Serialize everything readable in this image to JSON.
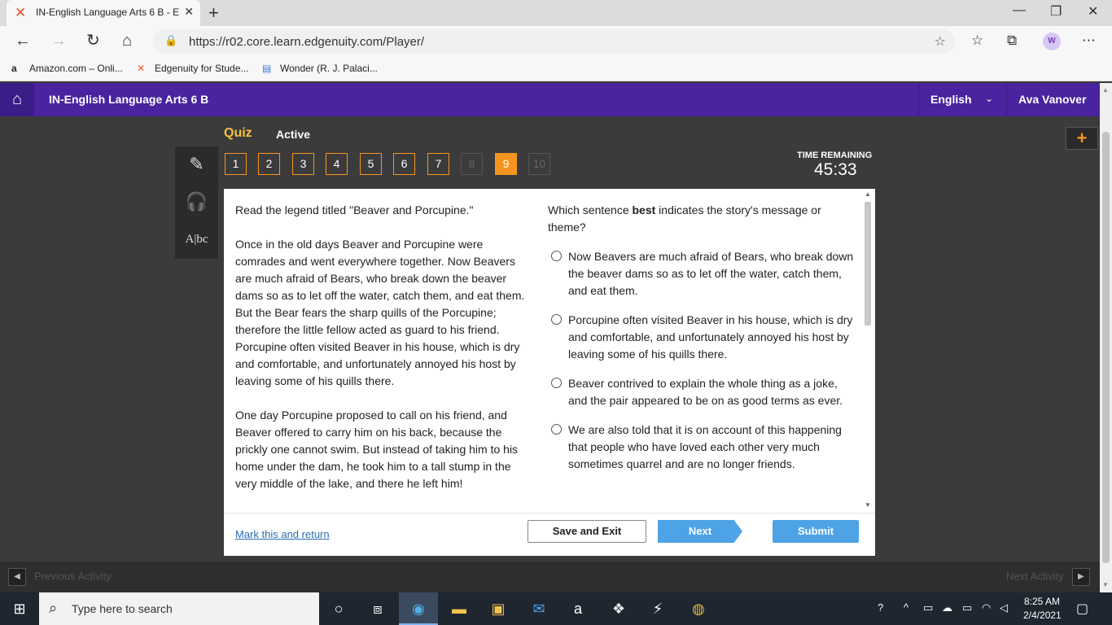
{
  "browser": {
    "tab_title": "IN-English Language Arts 6 B - E",
    "url": "https://r02.core.learn.edgenuity.com/Player/",
    "profile_initial": "W",
    "bookmarks": [
      "Amazon.com – Onli...",
      "Edgenuity for Stude...",
      "Wonder (R. J. Palaci..."
    ]
  },
  "app": {
    "course_title": "IN-English Language Arts 6 B",
    "language": "English",
    "user": "Ava Vanover"
  },
  "quiz": {
    "label": "Quiz",
    "status": "Active",
    "questions": [
      "1",
      "2",
      "3",
      "4",
      "5",
      "6",
      "7",
      "8",
      "9",
      "10"
    ],
    "current_question": "9",
    "timer_label": "TIME REMAINING",
    "timer_value": "45:33"
  },
  "passage": {
    "p1": "Read the legend titled \"Beaver and Porcupine.\"",
    "p2": "Once in the old days Beaver and Porcupine were comrades and went everywhere together. Now Beavers are much afraid of Bears, who break down the beaver dams so as to let off the water, catch them, and eat them. But the Bear fears the sharp quills of the Porcupine; therefore the little fellow acted as guard to his friend. Porcupine often visited Beaver in his house, which is dry and comfortable, and unfortunately annoyed his host by leaving some of his quills there.",
    "p3": "One day Porcupine proposed to call on his friend, and Beaver offered to carry him on his back, because the prickly one cannot swim. But instead of taking him to his home under the dam, he took him to a tall stump in the very middle of the lake, and there he left him!"
  },
  "question": {
    "prefix": "Which sentence ",
    "emphasis": "best",
    "suffix": " indicates the story's message or theme?",
    "options": [
      "Now Beavers are much afraid of Bears, who break down the beaver dams so as to let off the water, catch them, and eat them.",
      "Porcupine often visited Beaver in his house, which is dry and comfortable, and unfortunately annoyed his host by leaving some of his quills there.",
      "Beaver contrived to explain the whole thing as a joke, and the pair appeared to be on as good terms as ever.",
      "We are also told that it is on account of this happening that people who have loved each other very much sometimes quarrel and are no longer friends."
    ]
  },
  "footer": {
    "mark": "Mark this and return",
    "save": "Save and Exit",
    "next": "Next",
    "submit": "Submit",
    "prev_activity": "Previous Activity",
    "next_activity": "Next Activity"
  },
  "taskbar": {
    "search_placeholder": "Type here to search",
    "time": "8:25 AM",
    "date": "2/4/2021"
  },
  "colors": {
    "header": "#4a23a0",
    "accent": "#f7941e",
    "button_blue": "#4da3e6"
  }
}
